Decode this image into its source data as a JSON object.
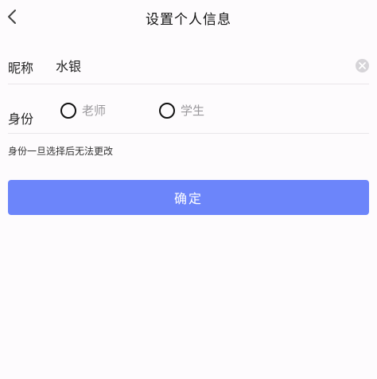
{
  "header": {
    "title": "设置个人信息",
    "back_icon": "chevron-left-icon"
  },
  "nickname": {
    "label": "昵称",
    "value": "水银",
    "clear_icon": "clear-circle-icon"
  },
  "identity": {
    "label": "身份",
    "options": [
      {
        "label": "老师",
        "selected": false
      },
      {
        "label": "学生",
        "selected": false
      }
    ]
  },
  "hint": "身份一旦选择后无法更改",
  "confirm_label": "确定",
  "colors": {
    "accent": "#6c85fa",
    "background": "#fdfbfd",
    "placeholder_text": "#9a989c"
  }
}
